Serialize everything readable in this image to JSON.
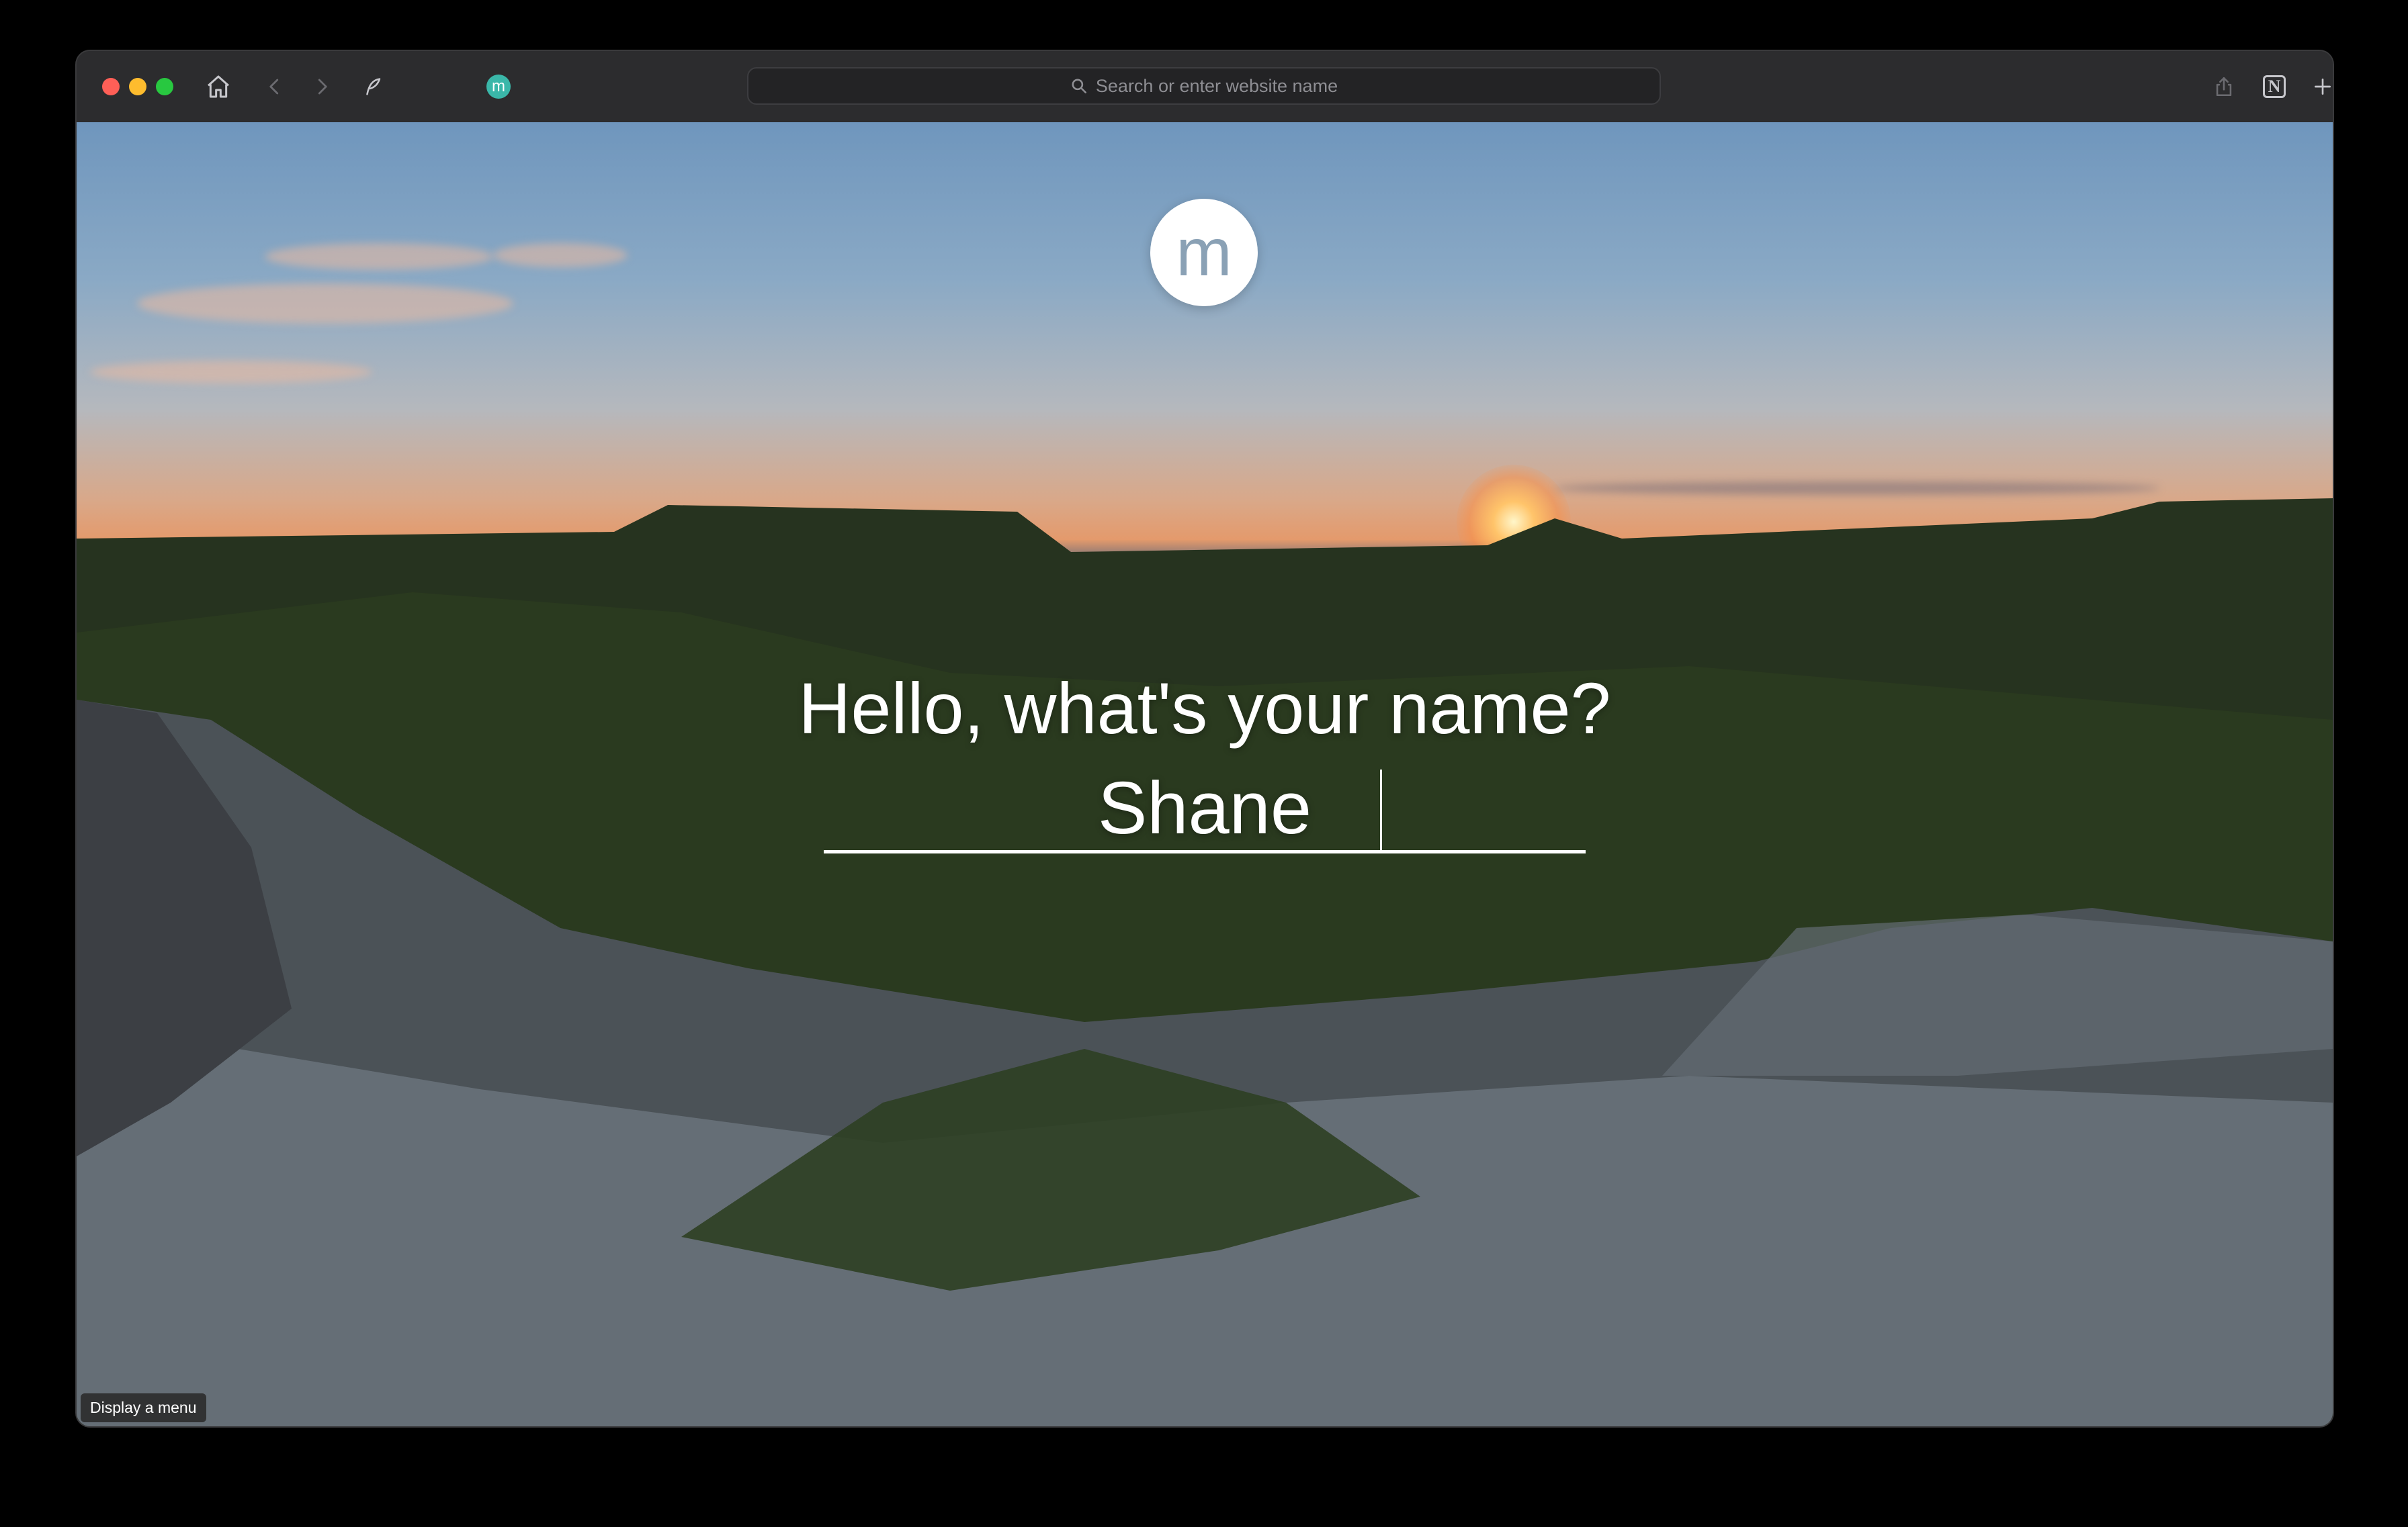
{
  "browser": {
    "toolbar_icons": {
      "home": "home-icon",
      "back": "chevron-left-icon",
      "forward": "chevron-right-icon",
      "extension_1": "feather-icon",
      "extension_2": "momentum-extension-icon",
      "share": "share-icon",
      "notion": "notion-icon",
      "new_tab": "plus-icon",
      "tab_overview": "grid-icon"
    },
    "extension_badge": "m",
    "notion_badge": "N",
    "url_bar": {
      "placeholder": "Search or enter website name"
    }
  },
  "page": {
    "logo_letter": "m",
    "greeting": "Hello, what's your name?",
    "name_input": {
      "value": "Shane"
    },
    "tooltip": "Display a menu"
  },
  "colors": {
    "close": "#ff5f57",
    "minimize": "#febc2e",
    "maximize": "#28c840",
    "extension_badge": "#3ab7a9"
  }
}
